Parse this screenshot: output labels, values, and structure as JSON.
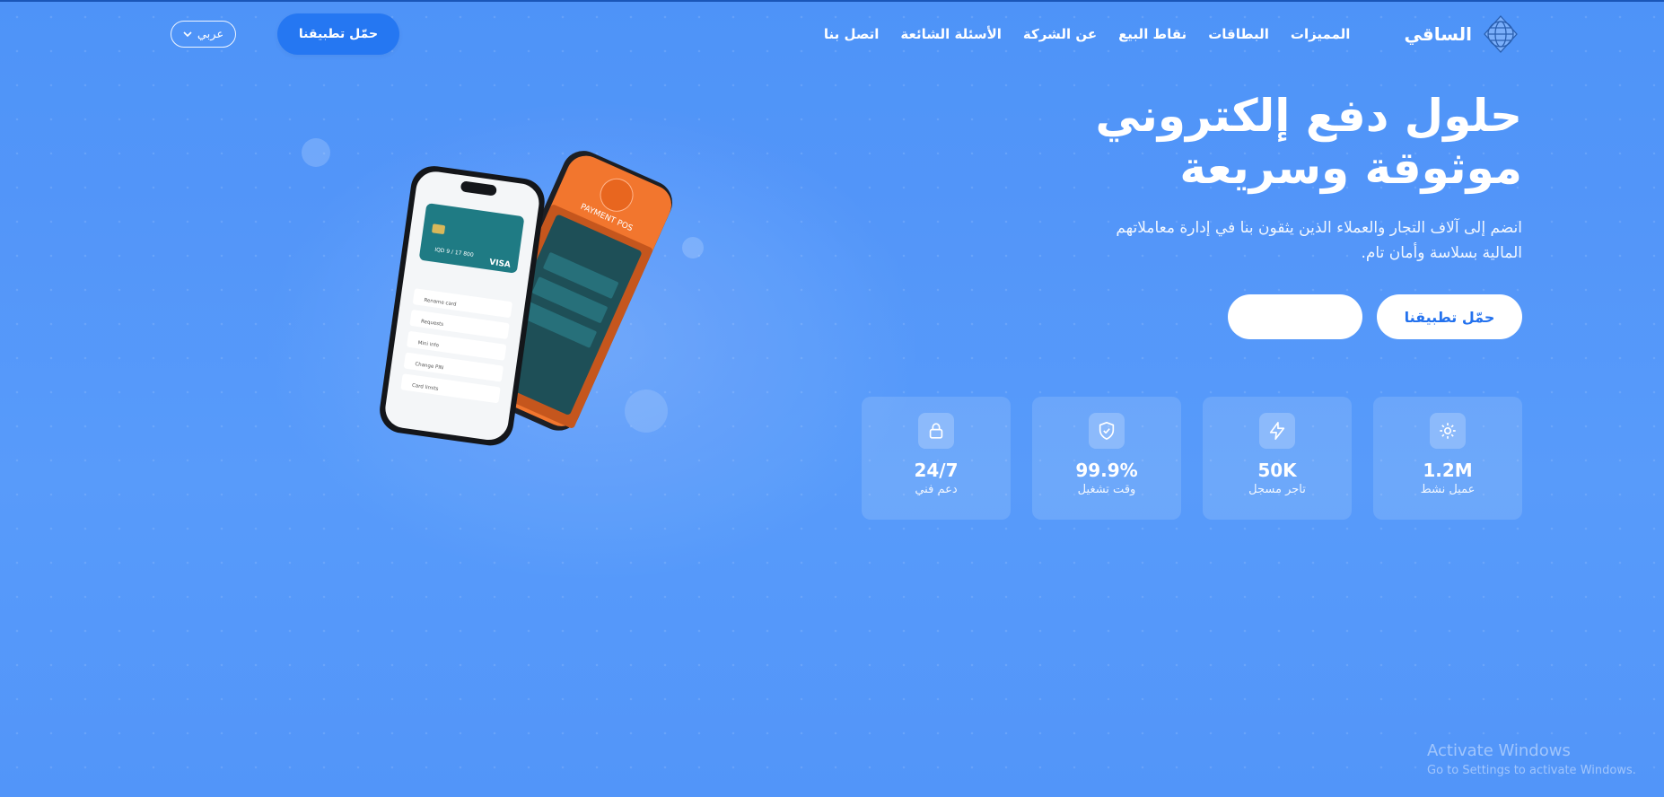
{
  "brand": {
    "name": "الساقي",
    "logo_icon": "globe-logo-icon"
  },
  "nav": {
    "items": [
      "المميزات",
      "البطاقات",
      "نقاط البيع",
      "عن الشركة",
      "الأسئلة الشائعة",
      "اتصل بنا"
    ]
  },
  "header": {
    "download_label": "حمّل تطبيقنا",
    "language_label": "عربي"
  },
  "hero": {
    "title": "حلول دفع إلكتروني\nموثوقة وسريعة",
    "subtitle": "انضم إلى آلاف التجار والعملاء الذين يثقون بنا في إدارة معاملاتهم المالية بسلاسة وأمان تام.",
    "primary_button": "حمّل تطبيقنا",
    "secondary_button": ""
  },
  "stats": [
    {
      "value": "1.2M",
      "label": "عميل نشط",
      "icon": "gear-icon"
    },
    {
      "value": "50K",
      "label": "تاجر مسجل",
      "icon": "lightning-icon"
    },
    {
      "value": "99.9%",
      "label": "وقت تشغيل",
      "icon": "shield-check-icon"
    },
    {
      "value": "24/7",
      "label": "دعم فني",
      "icon": "lock-icon"
    }
  ],
  "device": {
    "pos_label": "PAYMENT POS",
    "card_brand": "VISA",
    "card_number": "IQD 9 / 17 800",
    "phone_menu": [
      "Rename card",
      "Requests",
      "Mini info",
      "Change PIN",
      "Card limits"
    ]
  },
  "watermark": {
    "title": "Activate Windows",
    "subtitle": "Go to Settings to activate Windows."
  },
  "colors": {
    "background": "#2f82f7",
    "button_text": "#2472ee",
    "pos_orange": "#f2762e"
  }
}
